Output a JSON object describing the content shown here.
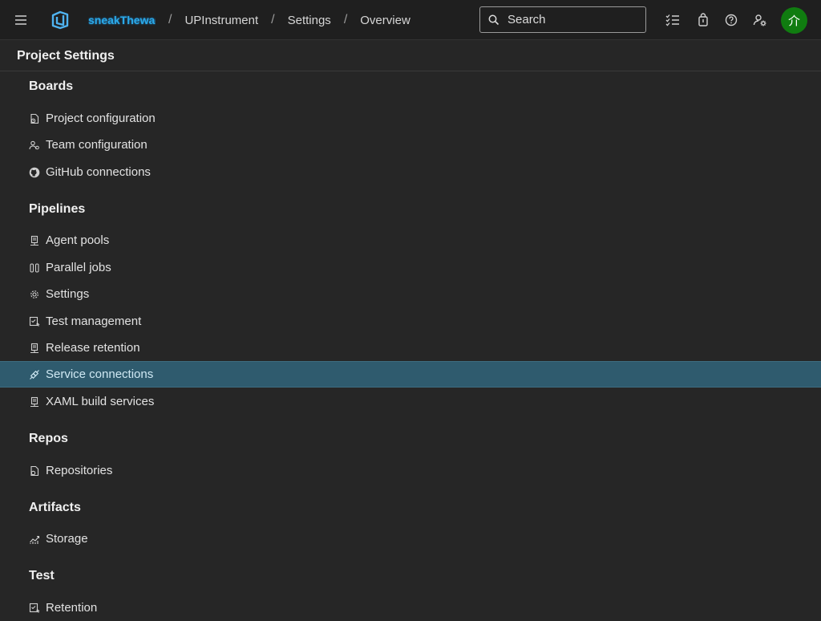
{
  "topbar": {
    "org": "sneakThewader",
    "breadcrumbs": [
      "UPInstrument",
      "Settings",
      "Overview"
    ],
    "search_placeholder": "Search",
    "avatar_initials": "介"
  },
  "header": {
    "title": "Project Settings"
  },
  "sections": [
    {
      "title": "Boards",
      "items": [
        "Project configuration",
        "Team configuration",
        "GitHub connections"
      ]
    },
    {
      "title": "Pipelines",
      "items": [
        "Agent pools",
        "Parallel jobs",
        "Settings",
        "Test management",
        "Release retention",
        "Service connections",
        "XAML build services"
      ]
    },
    {
      "title": "Repos",
      "items": [
        "Repositories"
      ]
    },
    {
      "title": "Artifacts",
      "items": [
        "Storage"
      ]
    },
    {
      "title": "Test",
      "items": [
        "Retention"
      ]
    }
  ],
  "selected_item": "Service connections",
  "colors": {
    "selected_bg": "#2f5b6e",
    "avatar": "#107c10",
    "org_link": "#2ba9e8"
  }
}
